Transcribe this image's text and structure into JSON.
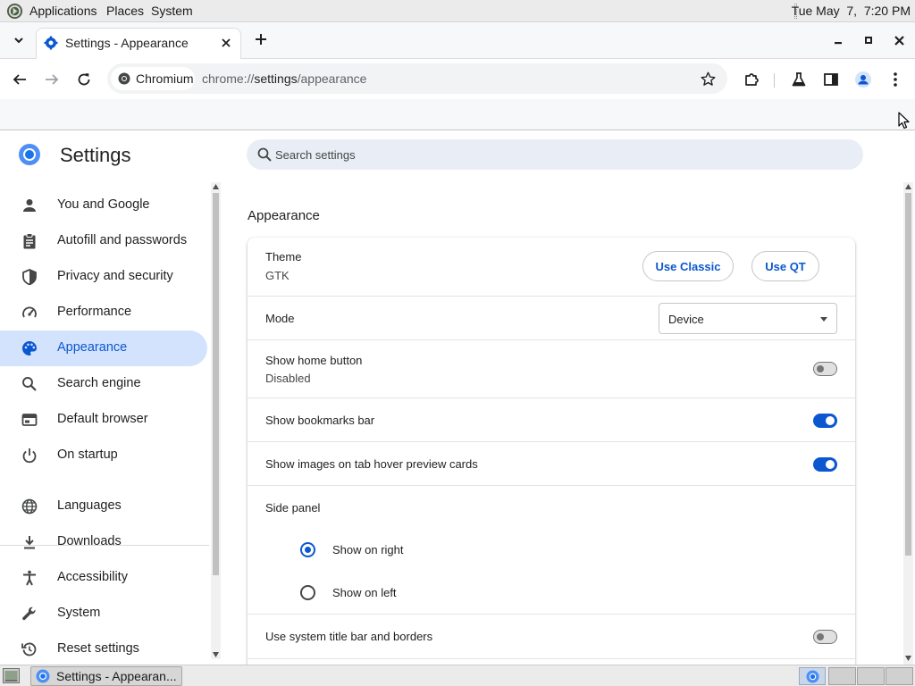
{
  "top_panel": {
    "menus": [
      "Applications",
      "Places",
      "System"
    ],
    "clock": "Tue May  7,  7:20 PM"
  },
  "browser": {
    "tab": {
      "title": "Settings - Appearance"
    },
    "omnibox": {
      "chip_label": "Chromium",
      "url_scheme": "chrome://",
      "url_host": "settings",
      "url_path": "/appearance"
    }
  },
  "settings": {
    "title": "Settings",
    "search_placeholder": "Search settings",
    "sidebar": [
      {
        "label": "You and Google",
        "icon": "person-icon"
      },
      {
        "label": "Autofill and passwords",
        "icon": "clipboard-icon"
      },
      {
        "label": "Privacy and security",
        "icon": "shield-icon"
      },
      {
        "label": "Performance",
        "icon": "speedometer-icon"
      },
      {
        "label": "Appearance",
        "icon": "palette-icon",
        "active": true
      },
      {
        "label": "Search engine",
        "icon": "search-icon"
      },
      {
        "label": "Default browser",
        "icon": "browser-window-icon"
      },
      {
        "label": "On startup",
        "icon": "power-icon"
      },
      {
        "label": "Languages",
        "icon": "globe-icon"
      },
      {
        "label": "Downloads",
        "icon": "download-icon"
      },
      {
        "label": "Accessibility",
        "icon": "accessibility-icon"
      },
      {
        "label": "System",
        "icon": "wrench-icon"
      },
      {
        "label": "Reset settings",
        "icon": "reset-icon"
      }
    ],
    "section_title": "Appearance",
    "theme": {
      "label": "Theme",
      "value": "GTK",
      "use_classic": "Use Classic",
      "use_qt": "Use QT"
    },
    "mode": {
      "label": "Mode",
      "selected": "Device"
    },
    "home_button": {
      "label": "Show home button",
      "sub": "Disabled",
      "enabled": false
    },
    "bookmarks_bar": {
      "label": "Show bookmarks bar",
      "enabled": true
    },
    "hover_cards": {
      "label": "Show images on tab hover preview cards",
      "enabled": true
    },
    "side_panel": {
      "label": "Side panel",
      "options": [
        {
          "label": "Show on right",
          "checked": true
        },
        {
          "label": "Show on left",
          "checked": false
        }
      ]
    },
    "title_bar": {
      "label": "Use system title bar and borders",
      "enabled": false
    }
  },
  "taskbar": {
    "task_label": "Settings - Appearan..."
  },
  "colors": {
    "accent": "#0b57d0",
    "active_nav_bg": "#d3e3fd",
    "search_bg": "#e9eef6"
  }
}
